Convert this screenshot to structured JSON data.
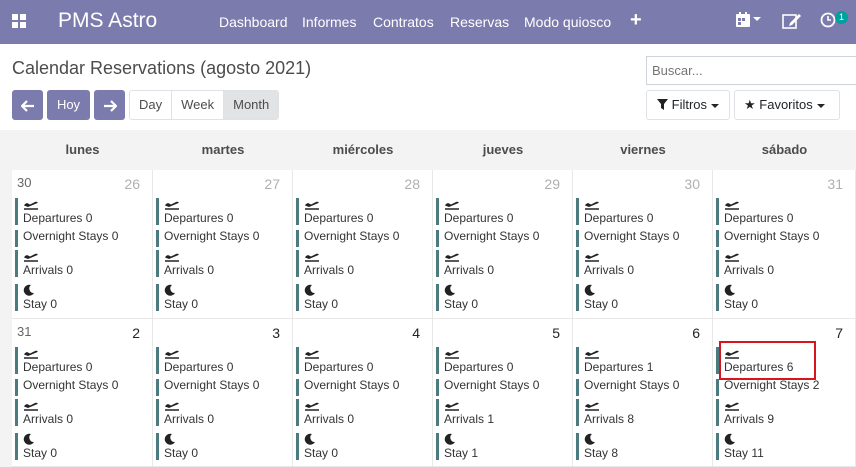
{
  "navbar": {
    "brand": "PMS Astro",
    "menu": [
      "Dashboard",
      "Informes",
      "Contratos",
      "Reservas",
      "Modo quiosco"
    ],
    "plus": "+",
    "activity_badge": "1",
    "color": "#7c7bad"
  },
  "control_panel": {
    "title": "Calendar Reservations (agosto 2021)",
    "search_placeholder": "Buscar...",
    "today_label": "Hoy",
    "prev_icon": "←",
    "next_icon": "→",
    "scales": [
      "Day",
      "Week",
      "Month"
    ],
    "active_scale": "Month",
    "filters_label": "Filtros",
    "favorites_label": "Favoritos"
  },
  "calendar": {
    "weekdays": [
      "lunes",
      "martes",
      "miércoles",
      "jueves",
      "viernes",
      "sábado"
    ],
    "weeks": [
      {
        "week_number": "30",
        "days": [
          {
            "day": "26",
            "other_month": true,
            "departures": "Departures 0",
            "overnight": "Overnight Stays 0",
            "arrivals": "Arrivals 0",
            "stay": "Stay 0"
          },
          {
            "day": "27",
            "other_month": true,
            "departures": "Departures 0",
            "overnight": "Overnight Stays 0",
            "arrivals": "Arrivals 0",
            "stay": "Stay 0"
          },
          {
            "day": "28",
            "other_month": true,
            "departures": "Departures 0",
            "overnight": "Overnight Stays 0",
            "arrivals": "Arrivals 0",
            "stay": "Stay 0"
          },
          {
            "day": "29",
            "other_month": true,
            "departures": "Departures 0",
            "overnight": "Overnight Stays 0",
            "arrivals": "Arrivals 0",
            "stay": "Stay 0"
          },
          {
            "day": "30",
            "other_month": true,
            "departures": "Departures 0",
            "overnight": "Overnight Stays 0",
            "arrivals": "Arrivals 0",
            "stay": "Stay 0"
          },
          {
            "day": "31",
            "other_month": true,
            "departures": "Departures 0",
            "overnight": "Overnight Stays 0",
            "arrivals": "Arrivals 0",
            "stay": "Stay 0"
          }
        ]
      },
      {
        "week_number": "31",
        "days": [
          {
            "day": "2",
            "other_month": false,
            "departures": "Departures 0",
            "overnight": "Overnight Stays 0",
            "arrivals": "Arrivals 0",
            "stay": "Stay 0"
          },
          {
            "day": "3",
            "other_month": false,
            "departures": "Departures 0",
            "overnight": "Overnight Stays 0",
            "arrivals": "Arrivals 0",
            "stay": "Stay 0"
          },
          {
            "day": "4",
            "other_month": false,
            "departures": "Departures 0",
            "overnight": "Overnight Stays 0",
            "arrivals": "Arrivals 0",
            "stay": "Stay 0"
          },
          {
            "day": "5",
            "other_month": false,
            "departures": "Departures 0",
            "overnight": "Overnight Stays 0",
            "arrivals": "Arrivals 1",
            "stay": "Stay 1"
          },
          {
            "day": "6",
            "other_month": false,
            "departures": "Departures 1",
            "overnight": "Overnight Stays 0",
            "arrivals": "Arrivals 8",
            "stay": "Stay 8"
          },
          {
            "day": "7",
            "other_month": false,
            "departures": "Departures 6",
            "overnight": "Overnight Stays 2",
            "arrivals": "Arrivals 9",
            "stay": "Stay 11"
          }
        ]
      }
    ],
    "event_bar_color": "#4c7b7f",
    "highlight_color": "#d9151c"
  }
}
